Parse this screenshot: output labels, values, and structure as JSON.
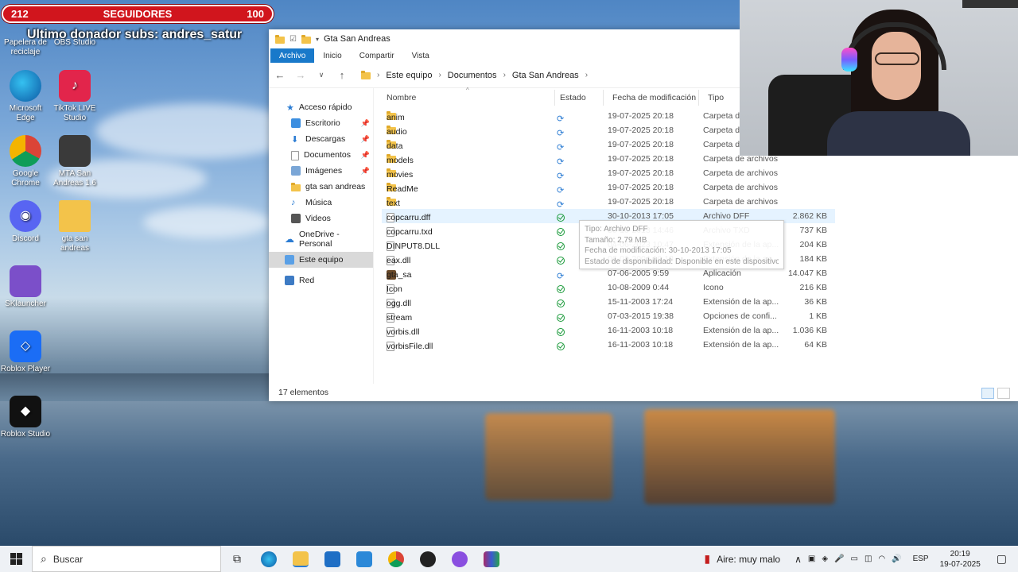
{
  "overlay": {
    "follow_count": "212",
    "follow_label": "SEGUIDORES",
    "follow_goal": "100",
    "donor_text": "Ultimo donador subs: andres_satur"
  },
  "desktop_icons": [
    {
      "label": "Papelera de reciclaje",
      "icon": "recycle-bin-icon"
    },
    {
      "label": "OBS Studio",
      "icon": "obs-icon"
    },
    {
      "label": "Microsoft Edge",
      "icon": "edge-icon"
    },
    {
      "label": "TikTok LIVE Studio",
      "icon": "tiktok-icon"
    },
    {
      "label": "Google Chrome",
      "icon": "chrome-icon"
    },
    {
      "label": "MTA San Andreas 1.6",
      "icon": "mta-icon"
    },
    {
      "label": "Discord",
      "icon": "discord-icon"
    },
    {
      "label": "gta san andreas",
      "icon": "folder-icon"
    },
    {
      "label": "SKlauncher",
      "icon": "sklauncher-icon"
    },
    {
      "label": "Roblox Player",
      "icon": "roblox-icon"
    },
    {
      "label": "Roblox Studio",
      "icon": "roblox-studio-icon"
    }
  ],
  "explorer": {
    "title": "Gta San Andreas",
    "ribbon_tabs": [
      "Archivo",
      "Inicio",
      "Compartir",
      "Vista"
    ],
    "breadcrumb": [
      "Este equipo",
      "Documentos",
      "Gta San Andreas"
    ],
    "nav_pane": [
      {
        "label": "Acceso rápido",
        "pinned": false
      },
      {
        "label": "Escritorio",
        "pinned": true
      },
      {
        "label": "Descargas",
        "pinned": true
      },
      {
        "label": "Documentos",
        "pinned": true
      },
      {
        "label": "Imágenes",
        "pinned": true
      },
      {
        "label": "gta san andreas",
        "pinned": false
      },
      {
        "label": "Música",
        "pinned": false
      },
      {
        "label": "Videos",
        "pinned": false
      },
      {
        "label": "OneDrive - Personal",
        "pinned": false
      },
      {
        "label": "Este equipo",
        "pinned": false
      },
      {
        "label": "Red",
        "pinned": false
      }
    ],
    "columns": [
      "Nombre",
      "Estado",
      "Fecha de modificación",
      "Tipo"
    ],
    "files": [
      {
        "name": "anim",
        "kind": "folder",
        "status": "sync",
        "date": "19-07-2025 20:18",
        "type": "Carpeta d",
        "size": ""
      },
      {
        "name": "audio",
        "kind": "folder",
        "status": "sync",
        "date": "19-07-2025 20:18",
        "type": "Carpeta d",
        "size": ""
      },
      {
        "name": "data",
        "kind": "folder",
        "status": "sync",
        "date": "19-07-2025 20:18",
        "type": "Carpeta d",
        "size": ""
      },
      {
        "name": "models",
        "kind": "folder",
        "status": "sync",
        "date": "19-07-2025 20:18",
        "type": "Carpeta de archivos",
        "size": ""
      },
      {
        "name": "movies",
        "kind": "folder",
        "status": "sync",
        "date": "19-07-2025 20:18",
        "type": "Carpeta de archivos",
        "size": ""
      },
      {
        "name": "ReadMe",
        "kind": "folder",
        "status": "sync",
        "date": "19-07-2025 20:18",
        "type": "Carpeta de archivos",
        "size": ""
      },
      {
        "name": "text",
        "kind": "folder",
        "status": "sync",
        "date": "19-07-2025 20:18",
        "type": "Carpeta de archivos",
        "size": ""
      },
      {
        "name": "copcarru.dff",
        "kind": "file",
        "status": "ok",
        "date": "30-10-2013 17:05",
        "type": "Archivo DFF",
        "size": "2.862 KB"
      },
      {
        "name": "copcarru.txd",
        "kind": "file",
        "status": "ok",
        "date": "30-10-2013 14:46",
        "type": "Archivo TXD",
        "size": "737 KB"
      },
      {
        "name": "DINPUT8.DLL",
        "kind": "file",
        "status": "ok",
        "date": "04-06-2023 10:47",
        "type": "Extensión de la ap...",
        "size": "204 KB"
      },
      {
        "name": "eax.dll",
        "kind": "file",
        "status": "ok",
        "date": "06-01-2004 10:13",
        "type": "Extensión de la ap...",
        "size": "184 KB"
      },
      {
        "name": "gta_sa",
        "kind": "exe",
        "status": "sync",
        "date": "07-06-2005 9:59",
        "type": "Aplicación",
        "size": "14.047 KB"
      },
      {
        "name": "Icon",
        "kind": "file",
        "status": "ok",
        "date": "10-08-2009 0:44",
        "type": "Icono",
        "size": "216 KB"
      },
      {
        "name": "ogg.dll",
        "kind": "file",
        "status": "ok",
        "date": "15-11-2003 17:24",
        "type": "Extensión de la ap...",
        "size": "36 KB"
      },
      {
        "name": "stream",
        "kind": "file",
        "status": "ok",
        "date": "07-03-2015 19:38",
        "type": "Opciones de confi...",
        "size": "1 KB"
      },
      {
        "name": "vorbis.dll",
        "kind": "file",
        "status": "ok",
        "date": "16-11-2003 10:18",
        "type": "Extensión de la ap...",
        "size": "1.036 KB"
      },
      {
        "name": "vorbisFile.dll",
        "kind": "file",
        "status": "ok",
        "date": "16-11-2003 10:18",
        "type": "Extensión de la ap...",
        "size": "64 KB"
      }
    ],
    "tooltip": {
      "type": "Tipo: Archivo DFF",
      "size": "Tamaño: 2,79 MB",
      "modified": "Fecha de modificación: 30-10-2013 17:05",
      "availability": "Estado de disponibilidad: Disponible en este dispositivo"
    },
    "status_text": "17 elementos"
  },
  "taskbar": {
    "search_placeholder": "Buscar",
    "air_quality": "Aire: muy malo",
    "language": "ESP",
    "time": "20:19",
    "date": "19-07-2025"
  },
  "colors": {
    "follow_bar": "#d1151d",
    "ribbon_file_tab": "#1979ca",
    "sync_blue": "#2b7cd3",
    "ok_green": "#1a9a3a"
  }
}
